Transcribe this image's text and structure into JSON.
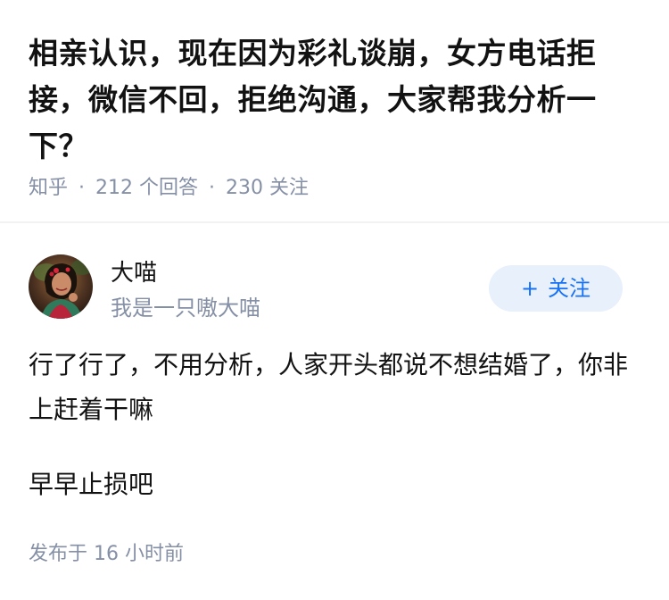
{
  "question": {
    "title": "相亲认识，现在因为彩礼谈崩，女方电话拒接，微信不回，拒绝沟通，大家帮我分析一下？",
    "source": "知乎",
    "separator": "·",
    "answer_count": "212",
    "answer_unit": "个回答",
    "follow_count": "230",
    "follow_unit": "关注"
  },
  "answer": {
    "author": {
      "name": "大喵",
      "bio": "我是一只嗷大喵",
      "avatar_icon": "avatar-photo"
    },
    "follow_button": {
      "plus": "+",
      "label": "关注"
    },
    "paragraphs": [
      "行了行了，不用分析，人家开头都说不想结婚了，你非上赶着干嘛",
      "早早止损吧"
    ],
    "published": {
      "prefix": "发布于",
      "time": "16 小时前"
    }
  },
  "colors": {
    "text": "#121212",
    "meta": "#8590a6",
    "accent": "#1772f6",
    "button_bg": "#e7f0fb",
    "divider": "#f2f2f2"
  }
}
